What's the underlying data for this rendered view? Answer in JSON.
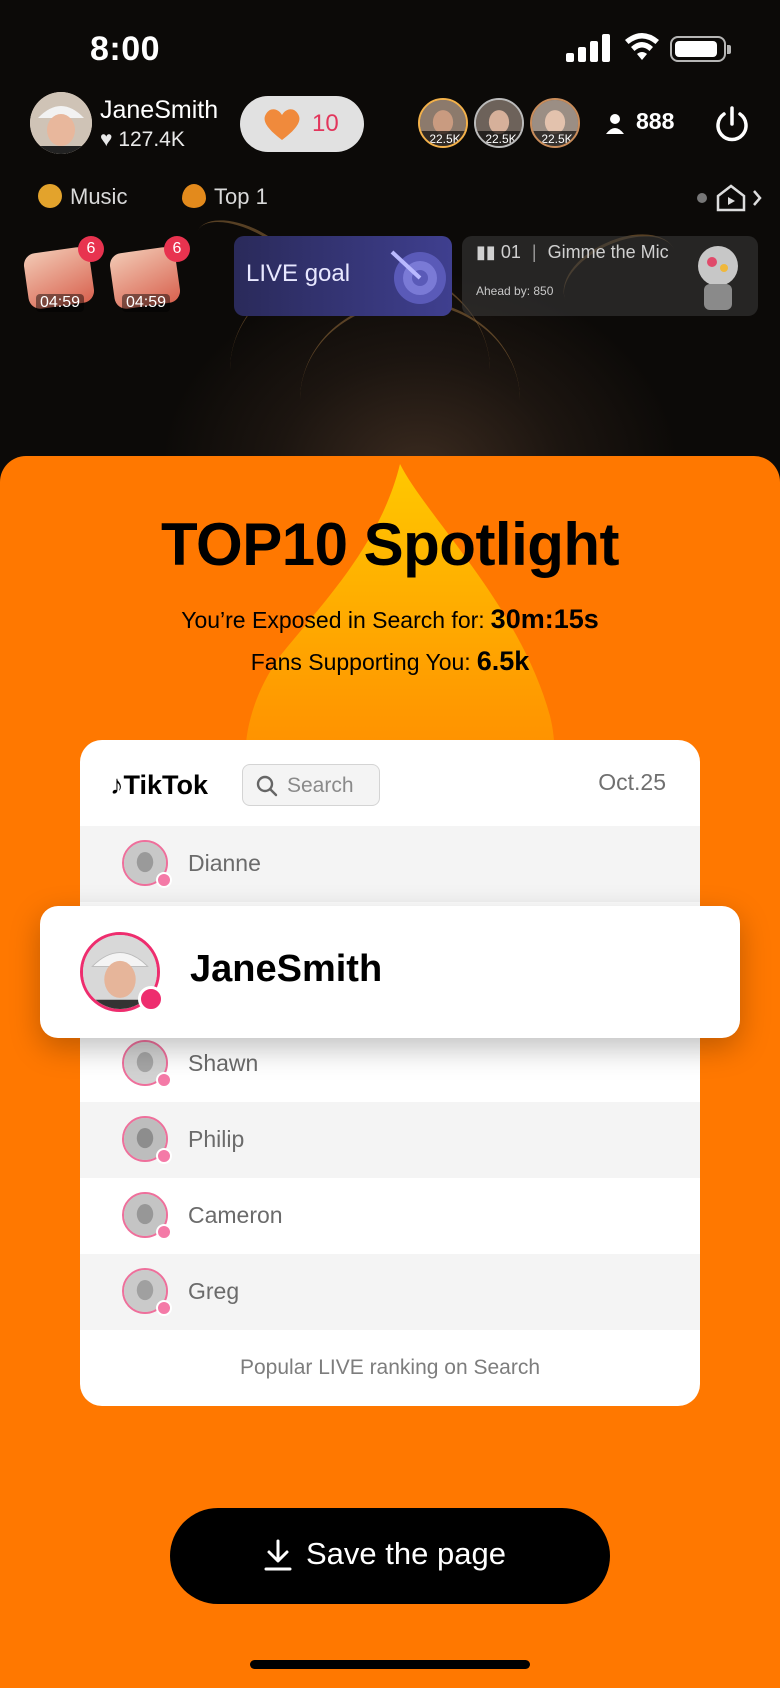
{
  "status_bar": {
    "time": "8:00"
  },
  "host": {
    "name": "JaneSmith",
    "likes": "127.4K"
  },
  "likes_pill": {
    "count": "10"
  },
  "viewers": {
    "avatars": [
      {
        "label": "22.5K"
      },
      {
        "label": "22.5K"
      },
      {
        "label": "22.5K"
      }
    ],
    "count": "888"
  },
  "tags": [
    {
      "label": "Music"
    },
    {
      "label": "Top 1"
    }
  ],
  "gifts": [
    {
      "timer": "04:59",
      "badge": "6"
    },
    {
      "timer": "04:59",
      "badge": "6"
    }
  ],
  "live_goal": {
    "label": "LIVE goal"
  },
  "rank_card": {
    "rank": "01",
    "song": "Gimme the Mic",
    "ahead": "Ahead by: 850"
  },
  "sheet": {
    "title": "TOP10 Spotlight",
    "exposed_label": "You’re Exposed in Search for:",
    "exposed_value": "30m:15s",
    "fans_label": "Fans Supporting You:",
    "fans_value": "6.5k"
  },
  "panel": {
    "brand": "TikTok",
    "search_placeholder": "Search",
    "date": "Oct.25",
    "rows": [
      {
        "name": "Dianne"
      },
      {
        "name": "Shawn"
      },
      {
        "name": "Philip"
      },
      {
        "name": "Cameron"
      },
      {
        "name": "Greg"
      }
    ],
    "featured": {
      "name": "JaneSmith"
    },
    "footer": "Popular LIVE ranking on Search"
  },
  "save_button": {
    "label": "Save the page"
  },
  "colors": {
    "accent": "#ff7800",
    "pink": "#ee2d6e",
    "button": "#000000"
  }
}
